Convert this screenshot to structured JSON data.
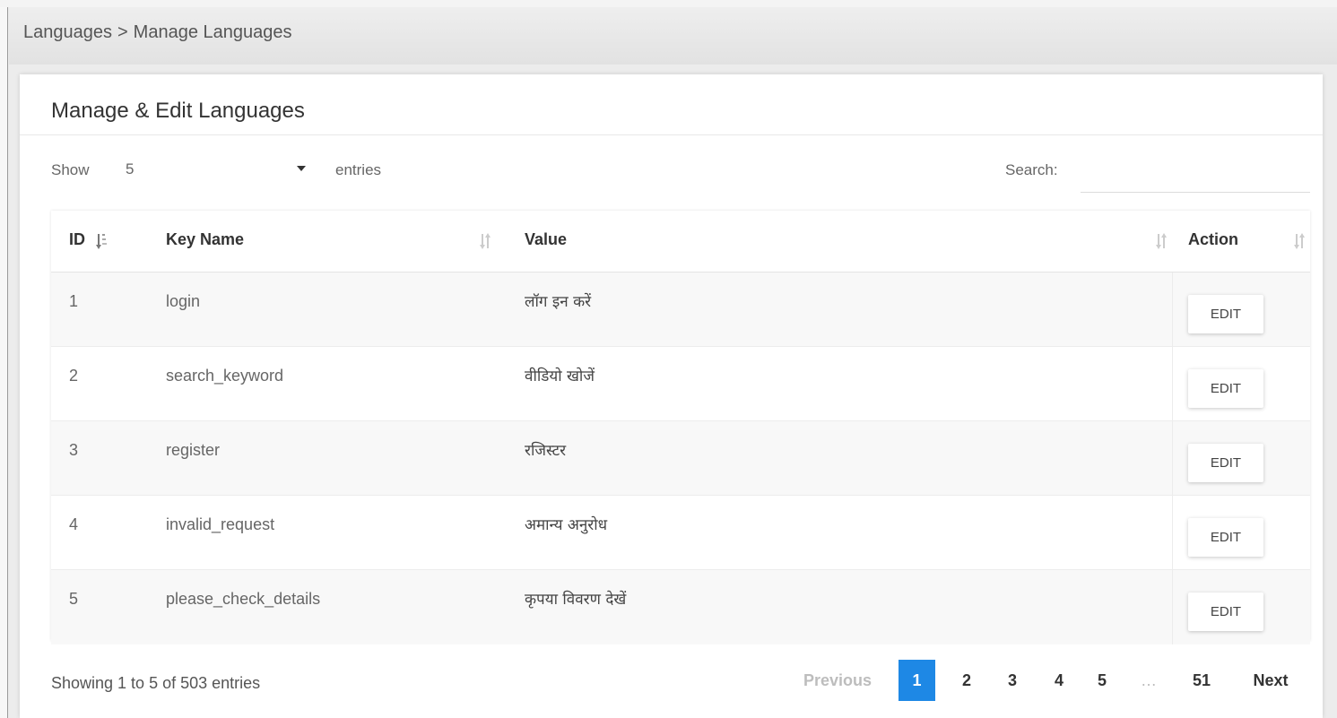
{
  "breadcrumb": {
    "parent": "Languages",
    "separator": ">",
    "current": "Manage Languages"
  },
  "panel": {
    "title": "Manage & Edit Languages"
  },
  "controls": {
    "show_label": "Show",
    "page_length": "5",
    "entries_label": "entries",
    "search_label": "Search:",
    "search_value": ""
  },
  "table": {
    "columns": [
      "ID",
      "Key Name",
      "Value",
      "Action"
    ],
    "rows": [
      {
        "id": "1",
        "key": "login",
        "value": "लॉग इन करें",
        "action": "EDIT"
      },
      {
        "id": "2",
        "key": "search_keyword",
        "value": "वीडियो खोजें",
        "action": "EDIT"
      },
      {
        "id": "3",
        "key": "register",
        "value": "रजिस्टर",
        "action": "EDIT"
      },
      {
        "id": "4",
        "key": "invalid_request",
        "value": "अमान्य अनुरोध",
        "action": "EDIT"
      },
      {
        "id": "5",
        "key": "please_check_details",
        "value": "कृपया विवरण देखें",
        "action": "EDIT"
      }
    ]
  },
  "footer": {
    "info": "Showing 1 to 5 of 503 entries"
  },
  "pagination": {
    "previous": "Previous",
    "pages": [
      "1",
      "2",
      "3",
      "4",
      "5"
    ],
    "ellipsis": "…",
    "last": "51",
    "next": "Next",
    "active_page": "1"
  },
  "colors": {
    "accent": "#1e88e5",
    "header_bar": "#e6e6e6",
    "striped_row": "#f8f8f8"
  },
  "icons": {
    "id_sort": "sort-ascending-icon",
    "column_sort": "sort-both-icon"
  }
}
